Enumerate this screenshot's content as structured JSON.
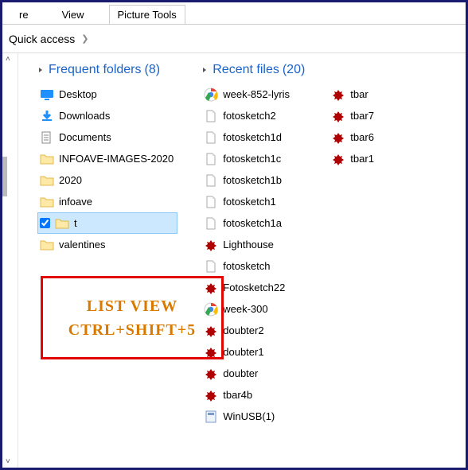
{
  "tabs": {
    "share": "re",
    "view": "View",
    "picture_tools": "Picture Tools"
  },
  "breadcrumb": {
    "location": "Quick access"
  },
  "sections": {
    "frequent": {
      "title": "Frequent folders",
      "count": 8
    },
    "recent": {
      "title": "Recent files",
      "count": 20
    }
  },
  "frequent_folders": [
    {
      "icon": "desktop",
      "label": "Desktop"
    },
    {
      "icon": "downloads",
      "label": "Downloads"
    },
    {
      "icon": "documents",
      "label": "Documents"
    },
    {
      "icon": "folder",
      "label": "INFOAVE-IMAGES-2020"
    },
    {
      "icon": "folder",
      "label": "2020"
    },
    {
      "icon": "folder",
      "label": "infoave"
    },
    {
      "icon": "folder",
      "label": "t",
      "selected": true
    },
    {
      "icon": "folder",
      "label": "valentines"
    }
  ],
  "recent_files_col1": [
    {
      "icon": "chrome",
      "label": "week-852-lyris"
    },
    {
      "icon": "file",
      "label": "fotosketch2"
    },
    {
      "icon": "file",
      "label": "fotosketch1d"
    },
    {
      "icon": "file",
      "label": "fotosketch1c"
    },
    {
      "icon": "file",
      "label": "fotosketch1b"
    },
    {
      "icon": "file",
      "label": "fotosketch1"
    },
    {
      "icon": "file",
      "label": "fotosketch1a"
    },
    {
      "icon": "bug",
      "label": "Lighthouse"
    },
    {
      "icon": "file",
      "label": "fotosketch"
    },
    {
      "icon": "bug",
      "label": "Fotosketch22"
    },
    {
      "icon": "chrome",
      "label": "week-300"
    },
    {
      "icon": "bug",
      "label": "doubter2"
    },
    {
      "icon": "bug",
      "label": "doubter1"
    },
    {
      "icon": "bug",
      "label": "doubter"
    },
    {
      "icon": "bug",
      "label": "tbar4b"
    },
    {
      "icon": "batch",
      "label": "WinUSB(1)"
    }
  ],
  "recent_files_col2": [
    {
      "icon": "bug",
      "label": "tbar"
    },
    {
      "icon": "bug",
      "label": "tbar7"
    },
    {
      "icon": "bug",
      "label": "tbar6"
    },
    {
      "icon": "bug",
      "label": "tbar1"
    }
  ],
  "annotation": {
    "line1": "LIST VIEW",
    "line2": "CTRL+SHIFT+5"
  }
}
